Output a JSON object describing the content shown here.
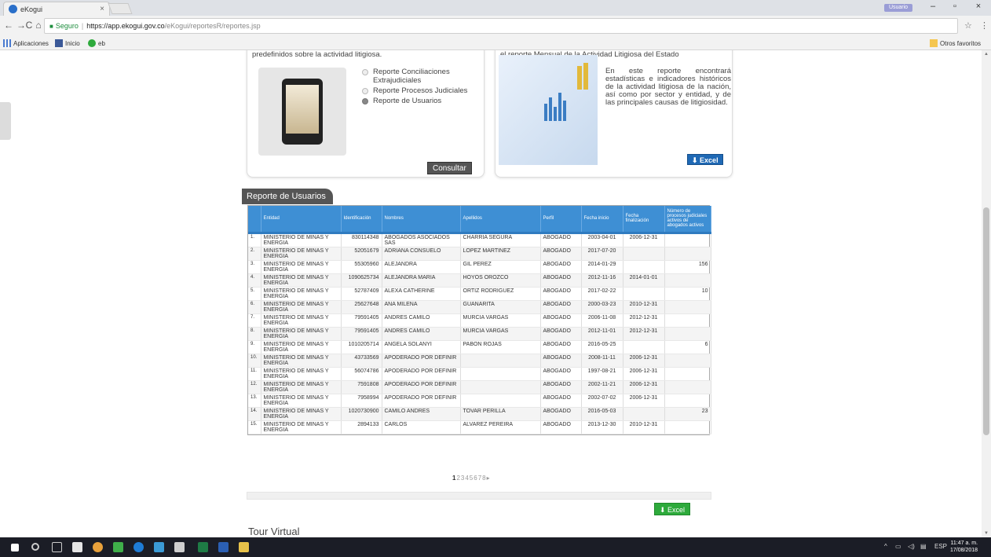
{
  "browser": {
    "tab_title": "eKogui",
    "tab_close": "×",
    "profile_label": "Usuario",
    "win_min": "–",
    "win_max": "▫",
    "win_close": "×",
    "nav_back": "←",
    "nav_forward": "→",
    "nav_reload": "C",
    "nav_home": "⌂",
    "secure_label": "Seguro",
    "url_host": "https://app.ekogui.gov.co",
    "url_path": "/eKogui/reportesR/reportes.jsp",
    "bookmarks": [
      "Aplicaciones",
      "Inicio",
      "eb"
    ],
    "bookmark_other": "Otros favoritos"
  },
  "cards": {
    "left_header": "predefinidos sobre la actividad litigiosa.",
    "options": [
      {
        "label": "Reporte Conciliaciones Extrajudiciales",
        "selected": false
      },
      {
        "label": "Reporte Procesos Judiciales",
        "selected": false
      },
      {
        "label": "Reporte de Usuarios",
        "selected": true
      }
    ],
    "consultar_label": "Consultar",
    "right_header": "el reporte Mensual de la Actividad Litigiosa del Estado",
    "right_text": "En este reporte encontrará estadísticas e indicadores históricos de la actividad litigiosa de la nación, así como por sector y entidad, y de las principales causas de litigiosidad.",
    "excel_top_label": "Excel"
  },
  "report": {
    "title": "Reporte de Usuarios",
    "columns": [
      "",
      "Entidad",
      "Identificación",
      "Nombres",
      "Apellidos",
      "Perfil",
      "Fecha inicio",
      "Fecha finalización",
      "Número de procesos judiciales activos de abogados activos"
    ],
    "rows": [
      [
        "1.",
        "MINISTERIO DE MINAS Y ENERGIA",
        "830114348",
        "ABOGADOS ASOCIADOS SAS",
        "CHARRIA SEGURA",
        "ABOGADO",
        "2003-04-01",
        "2006-12-31",
        ""
      ],
      [
        "2.",
        "MINISTERIO DE MINAS Y ENERGIA",
        "52051679",
        "ADRIANA CONSUELO",
        "LOPEZ MARTINEZ",
        "ABOGADO",
        "2017-07-20",
        "",
        ""
      ],
      [
        "3.",
        "MINISTERIO DE MINAS Y ENERGIA",
        "55305960",
        "ALEJANDRA",
        "GIL PEREZ",
        "ABOGADO",
        "2014-01-29",
        "",
        "156"
      ],
      [
        "4.",
        "MINISTERIO DE MINAS Y ENERGIA",
        "1090625734",
        "ALEJANDRA MARIA",
        "HOYOS OROZCO",
        "ABOGADO",
        "2012-11-16",
        "2014-01-01",
        ""
      ],
      [
        "5.",
        "MINISTERIO DE MINAS Y ENERGIA",
        "52787409",
        "ALEXA CATHERINE",
        "ORTIZ RODRIGUEZ",
        "ABOGADO",
        "2017-02-22",
        "",
        "10"
      ],
      [
        "6.",
        "MINISTERIO DE MINAS Y ENERGIA",
        "25627648",
        "ANA MILENA",
        "GUANARITA",
        "ABOGADO",
        "2000-03-23",
        "2010-12-31",
        ""
      ],
      [
        "7.",
        "MINISTERIO DE MINAS Y ENERGIA",
        "79591405",
        "ANDRES CAMILO",
        "MURCIA VARGAS",
        "ABOGADO",
        "2006-11-08",
        "2012-12-31",
        ""
      ],
      [
        "8.",
        "MINISTERIO DE MINAS Y ENERGIA",
        "79591405",
        "ANDRES CAMILO",
        "MURCIA VARGAS",
        "ABOGADO",
        "2012-11-01",
        "2012-12-31",
        ""
      ],
      [
        "9.",
        "MINISTERIO DE MINAS Y ENERGIA",
        "1010205714",
        "ANGELA SOLANYI",
        "PABON ROJAS",
        "ABOGADO",
        "2016-05-25",
        "",
        "6"
      ],
      [
        "10.",
        "MINISTERIO DE MINAS Y ENERGIA",
        "43733569",
        "APODERADO POR DEFINIR",
        "",
        "ABOGADO",
        "2008-11-11",
        "2006-12-31",
        ""
      ],
      [
        "11.",
        "MINISTERIO DE MINAS Y ENERGIA",
        "56074786",
        "APODERADO POR DEFINIR",
        "",
        "ABOGADO",
        "1997-08-21",
        "2006-12-31",
        ""
      ],
      [
        "12.",
        "MINISTERIO DE MINAS Y ENERGIA",
        "7591808",
        "APODERADO POR DEFINIR",
        "",
        "ABOGADO",
        "2002-11-21",
        "2006-12-31",
        ""
      ],
      [
        "13.",
        "MINISTERIO DE MINAS Y ENERGIA",
        "7958994",
        "APODERADO POR DEFINIR",
        "",
        "ABOGADO",
        "2002-07-02",
        "2006-12-31",
        ""
      ],
      [
        "14.",
        "MINISTERIO DE MINAS Y ENERGIA",
        "1020730900",
        "CAMILO ANDRES",
        "TOVAR PERILLA",
        "ABOGADO",
        "2016-05-03",
        "",
        "23"
      ],
      [
        "15.",
        "MINISTERIO DE MINAS Y ENERGIA",
        "2894133",
        "CARLOS",
        "ALVAREZ PEREIRA",
        "ABOGADO",
        "2013-12-30",
        "2010-12-31",
        ""
      ]
    ],
    "pagination": {
      "current": "1",
      "others": "2345678",
      "next": "▸"
    },
    "excel_bottom_label": "Excel"
  },
  "tour_label": "Tour Virtual",
  "taskbar": {
    "lang": "ESP",
    "time": "11:47 a. m.",
    "date": "17/08/2018"
  },
  "colors": {
    "header_blue": "#3e8fd4",
    "excel_green": "#2eaa3c",
    "excel_blue": "#1f69b5"
  }
}
